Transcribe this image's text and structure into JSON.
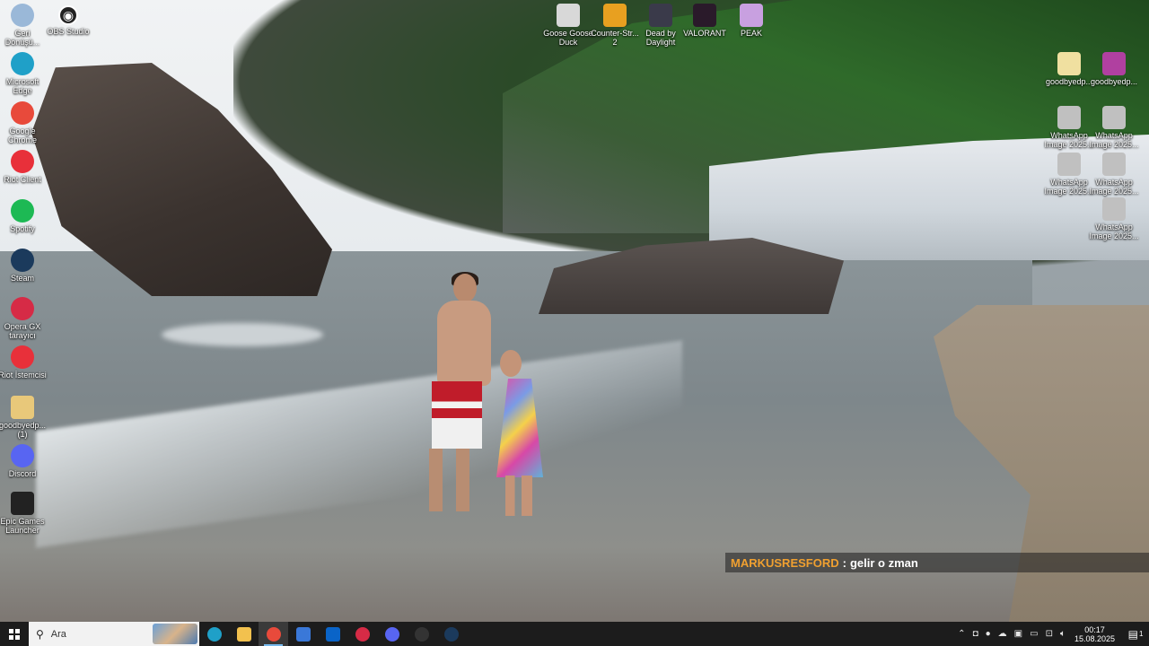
{
  "desktop_icons_left": [
    {
      "label": "Geri Dönüşü...",
      "icon": "recycle-bin-icon",
      "color": "#9ab8d8"
    },
    {
      "label": "Microsoft Edge",
      "icon": "edge-icon",
      "color": "#1fa0c8"
    },
    {
      "label": "Google Chrome",
      "icon": "chrome-icon",
      "color": "#e84a3b"
    },
    {
      "label": "Riot Client",
      "icon": "riot-client-icon",
      "color": "#e8303a"
    },
    {
      "label": "Spotify",
      "icon": "spotify-icon",
      "color": "#1db954"
    },
    {
      "label": "Steam",
      "icon": "steam-icon",
      "color": "#1b3a5c"
    },
    {
      "label": "Opera GX tarayıcı",
      "icon": "opera-gx-icon",
      "color": "#d62b46"
    },
    {
      "label": "Riot İstemcisi",
      "icon": "riot-istemcisi-icon",
      "color": "#e8303a"
    },
    {
      "label": "goodbyedp... (1)",
      "icon": "file-icon",
      "color": "#e8c87a"
    },
    {
      "label": "Discord",
      "icon": "discord-icon",
      "color": "#5865f2"
    },
    {
      "label": "Epic Games Launcher",
      "icon": "epic-games-icon",
      "color": "#222222"
    }
  ],
  "obs": {
    "label": "OBS Studio",
    "icon": "obs-icon",
    "color": "#222222"
  },
  "desktop_icons_top": [
    {
      "label": "Goose Goose Duck",
      "icon": "goose-goose-duck-icon",
      "color": "#d8d8d8"
    },
    {
      "label": "Counter-Str... 2",
      "icon": "counter-strike-icon",
      "color": "#e8a020"
    },
    {
      "label": "Dead by Daylight",
      "icon": "dead-by-daylight-icon",
      "color": "#3a3a4a"
    },
    {
      "label": "VALORANT",
      "icon": "valorant-icon",
      "color": "#2a1a2a"
    },
    {
      "label": "PEAK",
      "icon": "peak-icon",
      "color": "#c8a0e0"
    }
  ],
  "desktop_icons_right": [
    {
      "label": "goodbyedp...",
      "icon": "file-icon",
      "color": "#f0e0a0"
    },
    {
      "label": "goodbyedp...",
      "icon": "winrar-icon",
      "color": "#b040a0"
    },
    {
      "label": "WhatsApp Image 2025...",
      "icon": "image-icon",
      "color": "#c0c0c0"
    },
    {
      "label": "WhatsApp Image 2025...",
      "icon": "image-icon",
      "color": "#c0c0c0"
    },
    {
      "label": "WhatsApp Image 2025...",
      "icon": "image-icon",
      "color": "#c0c0c0"
    },
    {
      "label": "WhatsApp Image 2025...",
      "icon": "image-icon",
      "color": "#c0c0c0"
    },
    {
      "label": "WhatsApp Image 2025...",
      "icon": "image-icon",
      "color": "#c0c0c0"
    }
  ],
  "chat": {
    "user": "MARKUSRESFORD",
    "separator": ":",
    "message": "gelir o zman"
  },
  "taskbar": {
    "search_placeholder": "Ara",
    "apps": [
      {
        "name": "edge",
        "icon": "edge-icon",
        "color": "#1fa0c8",
        "active": false
      },
      {
        "name": "file-explorer",
        "icon": "folder-icon",
        "color": "#f2c14e",
        "active": false
      },
      {
        "name": "chrome",
        "icon": "chrome-icon",
        "color": "#e84a3b",
        "active": true
      },
      {
        "name": "store",
        "icon": "store-icon",
        "color": "#3a78d8",
        "active": false
      },
      {
        "name": "outlook",
        "icon": "outlook-icon",
        "color": "#0a64c8",
        "active": false
      },
      {
        "name": "opera-gx",
        "icon": "opera-gx-icon",
        "color": "#d62b46",
        "active": false
      },
      {
        "name": "discord-app",
        "icon": "discord-icon",
        "color": "#5865f2",
        "active": false
      },
      {
        "name": "obs-app",
        "icon": "obs-icon",
        "color": "#333333",
        "active": false
      },
      {
        "name": "steam-app",
        "icon": "steam-icon",
        "color": "#1b3a5c",
        "active": false
      }
    ],
    "time": "00:17",
    "date": "15.08.2025",
    "notification_count": "1"
  }
}
